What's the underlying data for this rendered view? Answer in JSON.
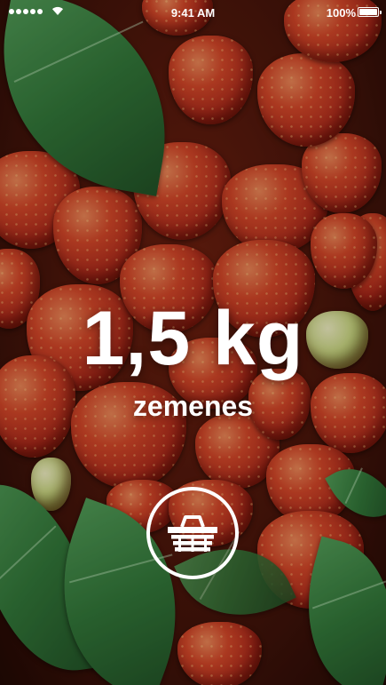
{
  "status_bar": {
    "time": "9:41 AM",
    "battery_percent": "100%",
    "battery_level": 1.0,
    "signal_bars": 5,
    "icons": [
      "cellular-signal-icon",
      "wifi-icon",
      "battery-icon"
    ]
  },
  "main": {
    "amount": "1,5 kg",
    "product": "zemenes",
    "action_icon": "basket-icon"
  },
  "background": {
    "subject": "strawberries",
    "colors": {
      "berry": "#c8391f",
      "leaf": "#2f7a3b",
      "text": "#ffffff"
    }
  }
}
